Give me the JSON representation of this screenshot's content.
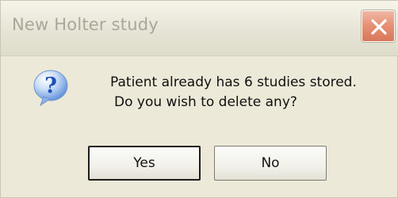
{
  "window": {
    "title": "New Holter study"
  },
  "titlebar": {
    "close_icon": "close-icon"
  },
  "dialog": {
    "icon": "question-icon",
    "message_line1": "Patient already has 6 studies stored.",
    "message_line2": "Do you wish to delete any?"
  },
  "buttons": {
    "yes_label": "Yes",
    "no_label": "No"
  },
  "colors": {
    "background": "#ece9d8",
    "close_button": "#e58f73",
    "icon_blue": "#2c63c9"
  }
}
